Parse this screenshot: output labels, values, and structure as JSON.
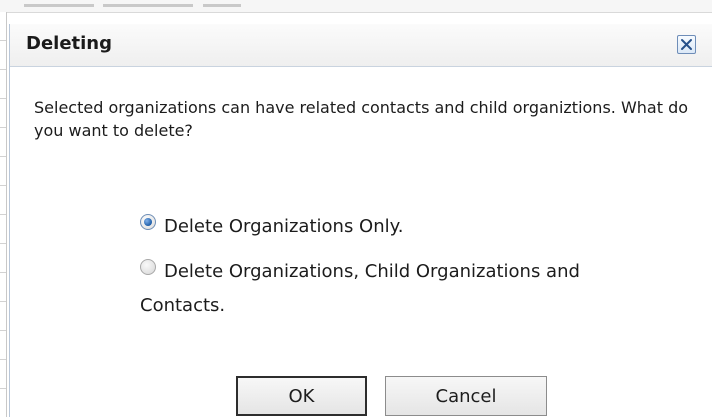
{
  "dialog": {
    "title": "Deleting",
    "message": "Selected organizations can have related contacts and child organiztions. What do you want to delete?",
    "options": [
      {
        "label": "Delete Organizations Only.",
        "selected": true
      },
      {
        "label_line1": "Delete Organizations, Child Organizations and",
        "label_line2": "Contacts.",
        "selected": false
      }
    ],
    "buttons": {
      "ok": "OK",
      "cancel": "Cancel"
    },
    "close_icon": "close-icon"
  },
  "colors": {
    "dialog_background": "#ffffff",
    "header_background": "#efefef",
    "accent_blue": "#1d5da8",
    "button_border": "#8c8c8c",
    "text": "#1c1c1c"
  }
}
